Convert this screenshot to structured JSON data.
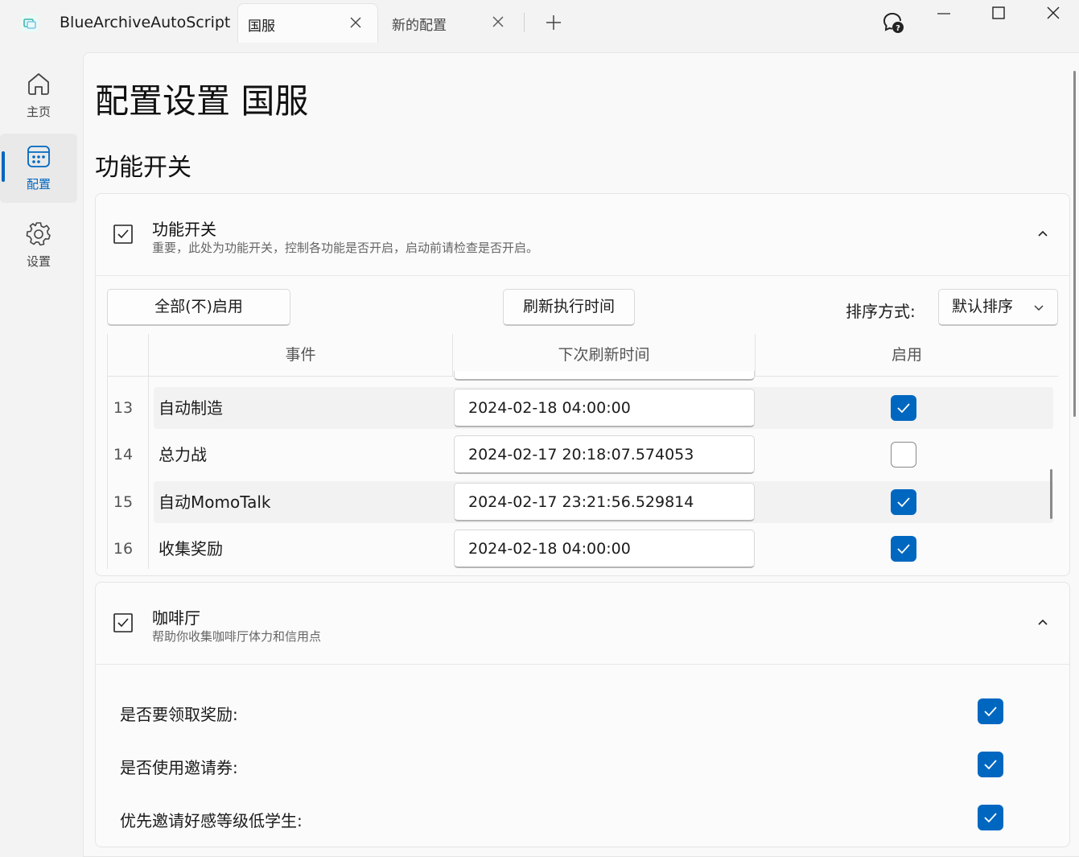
{
  "app": {
    "title": "BlueArchiveAutoScript"
  },
  "tabs": [
    {
      "label": "国服",
      "active": true
    },
    {
      "label": "新的配置",
      "active": false
    }
  ],
  "nav": [
    {
      "label": "主页",
      "icon": "home-icon"
    },
    {
      "label": "配置",
      "icon": "calendar-grid-icon",
      "selected": true
    },
    {
      "label": "设置",
      "icon": "gear-icon"
    }
  ],
  "page": {
    "title": "配置设置 国服",
    "section_title": "功能开关"
  },
  "feature_card": {
    "title": "功能开关",
    "description": "重要，此处为功能开关，控制各功能是否开启，启动前请检查是否开启。",
    "toggle_all_label": "全部(不)启用",
    "refresh_label": "刷新执行时间",
    "sort_label": "排序方式:",
    "sort_value": "默认排序",
    "columns": {
      "event": "事件",
      "next_refresh": "下次刷新时间",
      "enabled": "启用"
    },
    "rows": [
      {
        "num": "13",
        "event": "自动制造",
        "time": "2024-02-18 04:00:00",
        "enabled": true
      },
      {
        "num": "14",
        "event": "总力战",
        "time": "2024-02-17 20:18:07.574053",
        "enabled": false
      },
      {
        "num": "15",
        "event": "自动MomoTalk",
        "time": "2024-02-17 23:21:56.529814",
        "enabled": true
      },
      {
        "num": "16",
        "event": "收集奖励",
        "time": "2024-02-18 04:00:00",
        "enabled": true
      }
    ]
  },
  "cafe_card": {
    "title": "咖啡厅",
    "description": "帮助你收集咖啡厅体力和信用点",
    "options": [
      {
        "label": "是否要领取奖励:",
        "checked": true
      },
      {
        "label": "是否使用邀请券:",
        "checked": true
      },
      {
        "label": "优先邀请好感等级低学生:",
        "checked": true
      }
    ]
  },
  "colors": {
    "accent": "#0067c0"
  }
}
